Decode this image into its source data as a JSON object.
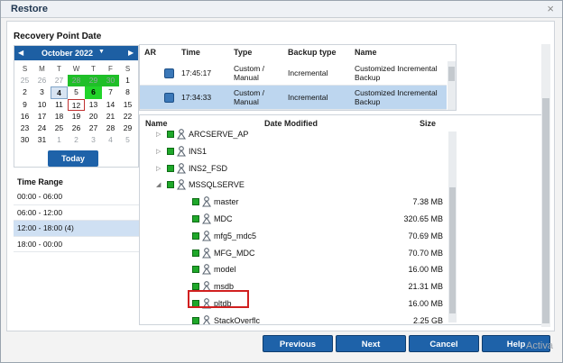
{
  "dialog": {
    "title": "Restore",
    "close": "×"
  },
  "recovery_point": {
    "label": "Recovery Point Date",
    "calendar": {
      "month": "October 2022",
      "prev": "◀",
      "next": "▶",
      "dropdown": "▼",
      "weekdays": [
        "S",
        "M",
        "T",
        "W",
        "T",
        "F",
        "S"
      ],
      "weeks": [
        [
          {
            "d": "25",
            "t": "other"
          },
          {
            "d": "26",
            "t": "other"
          },
          {
            "d": "27",
            "t": "other"
          },
          {
            "d": "28",
            "t": "other g"
          },
          {
            "d": "29",
            "t": "other g"
          },
          {
            "d": "30",
            "t": "other g"
          },
          {
            "d": "1",
            "t": ""
          }
        ],
        [
          {
            "d": "2",
            "t": ""
          },
          {
            "d": "3",
            "t": ""
          },
          {
            "d": "4",
            "t": "sel"
          },
          {
            "d": "5",
            "t": ""
          },
          {
            "d": "6",
            "t": "gb"
          },
          {
            "d": "7",
            "t": ""
          },
          {
            "d": "8",
            "t": ""
          }
        ],
        [
          {
            "d": "9",
            "t": ""
          },
          {
            "d": "10",
            "t": ""
          },
          {
            "d": "11",
            "t": ""
          },
          {
            "d": "12",
            "t": "today"
          },
          {
            "d": "13",
            "t": ""
          },
          {
            "d": "14",
            "t": ""
          },
          {
            "d": "15",
            "t": ""
          }
        ],
        [
          {
            "d": "16",
            "t": ""
          },
          {
            "d": "17",
            "t": ""
          },
          {
            "d": "18",
            "t": ""
          },
          {
            "d": "19",
            "t": ""
          },
          {
            "d": "20",
            "t": ""
          },
          {
            "d": "21",
            "t": ""
          },
          {
            "d": "22",
            "t": ""
          }
        ],
        [
          {
            "d": "23",
            "t": ""
          },
          {
            "d": "24",
            "t": ""
          },
          {
            "d": "25",
            "t": ""
          },
          {
            "d": "26",
            "t": ""
          },
          {
            "d": "27",
            "t": ""
          },
          {
            "d": "28",
            "t": ""
          },
          {
            "d": "29",
            "t": ""
          }
        ],
        [
          {
            "d": "30",
            "t": ""
          },
          {
            "d": "31",
            "t": ""
          },
          {
            "d": "1",
            "t": "other"
          },
          {
            "d": "2",
            "t": "other"
          },
          {
            "d": "3",
            "t": "other"
          },
          {
            "d": "4",
            "t": "other"
          },
          {
            "d": "5",
            "t": "other"
          }
        ]
      ],
      "today_button": "Today"
    }
  },
  "time_range": {
    "label": "Time Range",
    "items": [
      {
        "text": "00:00 - 06:00",
        "selected": false
      },
      {
        "text": "06:00 - 12:00",
        "selected": false
      },
      {
        "text": "12:00 - 18:00   (4)",
        "selected": true
      },
      {
        "text": "18:00 - 00:00",
        "selected": false
      }
    ]
  },
  "recovery_points_table": {
    "headers": [
      "AR",
      "Time",
      "Type",
      "Backup type",
      "Name"
    ],
    "rows": [
      {
        "time": "17:45:17",
        "type_l1": "Custom /",
        "type_l2": "Manual",
        "backup_type": "Incremental",
        "name_l1": "Customized Incremental",
        "name_l2": "Backup",
        "selected": false
      },
      {
        "time": "17:34:33",
        "type_l1": "Custom /",
        "type_l2": "Manual",
        "backup_type": "Incremental",
        "name_l1": "Customized Incremental",
        "name_l2": "Backup",
        "selected": true
      }
    ]
  },
  "files_table": {
    "headers": {
      "name": "Name",
      "date": "Date Modified",
      "size": "Size"
    },
    "rows": [
      {
        "name": "ARCSERVE_AP",
        "size": "",
        "level": 1,
        "arrow": "▷"
      },
      {
        "name": "INS1",
        "size": "",
        "level": 1,
        "arrow": "▷"
      },
      {
        "name": "INS2_FSD",
        "size": "",
        "level": 1,
        "arrow": "▷"
      },
      {
        "name": "MSSQLSERVE",
        "size": "",
        "level": 1,
        "arrow": "◢"
      },
      {
        "name": "master",
        "size": "7.38 MB",
        "level": 2,
        "arrow": ""
      },
      {
        "name": "MDC",
        "size": "320.65 MB",
        "level": 2,
        "arrow": ""
      },
      {
        "name": "mfg5_mdc5",
        "size": "70.69 MB",
        "level": 2,
        "arrow": ""
      },
      {
        "name": "MFG_MDC",
        "size": "70.70 MB",
        "level": 2,
        "arrow": ""
      },
      {
        "name": "model",
        "size": "16.00 MB",
        "level": 2,
        "arrow": ""
      },
      {
        "name": "msdb",
        "size": "21.31 MB",
        "level": 2,
        "arrow": ""
      },
      {
        "name": "pltdb",
        "size": "16.00 MB",
        "level": 2,
        "arrow": ""
      },
      {
        "name": "StackOverflc",
        "size": "2.25 GB",
        "level": 2,
        "arrow": ""
      }
    ]
  },
  "buttons": {
    "previous": "Previous",
    "next": "Next",
    "cancel": "Cancel",
    "help": "Help"
  },
  "watermark": "Activa",
  "colors": {
    "primary_button": "#1e62a9",
    "checkbox": "#1fa82a",
    "highlight": "#d11f1f"
  }
}
